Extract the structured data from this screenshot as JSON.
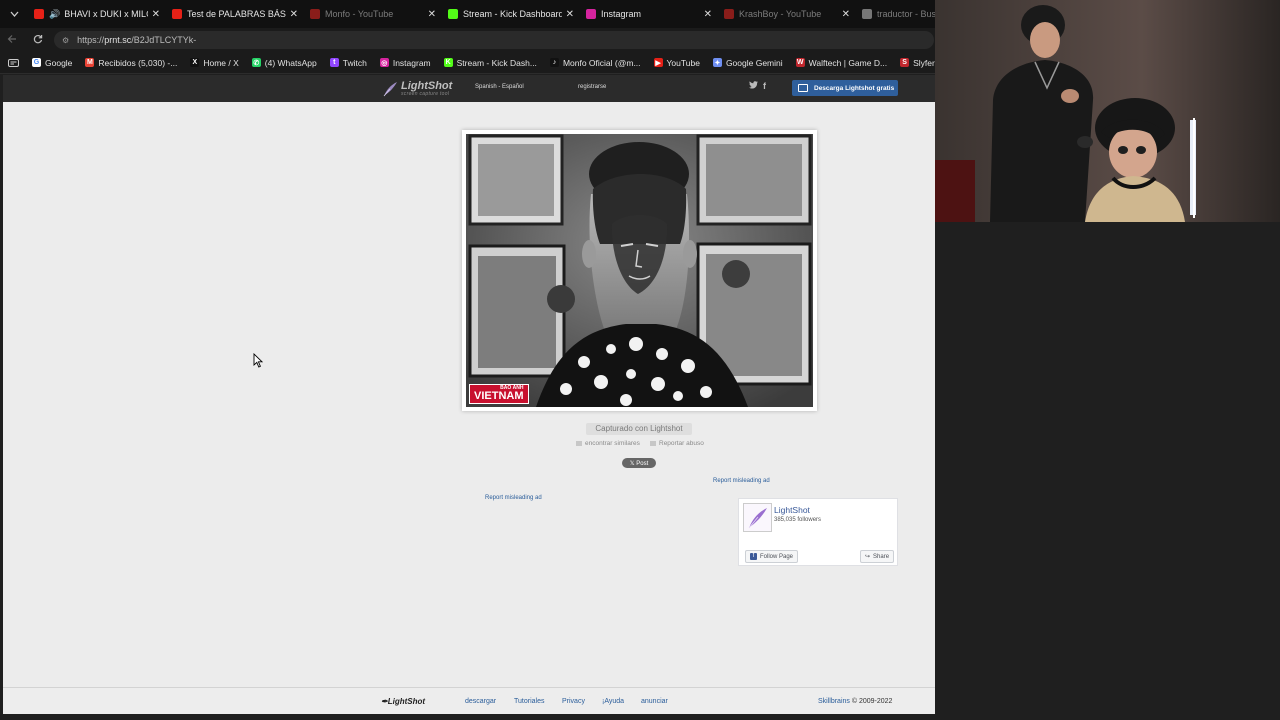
{
  "browser": {
    "tabs": [
      {
        "title": "BHAVI x DUKI x MILO J",
        "favicon": "youtube",
        "color": "#e62117",
        "active": true,
        "audio": true,
        "dim": false
      },
      {
        "title": "Test de PALABRAS BÁSICAS",
        "favicon": "youtube",
        "color": "#e62117",
        "active": false,
        "audio": false,
        "dim": false
      },
      {
        "title": "Monfo - YouTube",
        "favicon": "youtube",
        "color": "#8a1d1a",
        "active": false,
        "audio": false,
        "dim": true
      },
      {
        "title": "Stream - Kick Dashboard",
        "favicon": "kick",
        "color": "#53fc18",
        "active": false,
        "audio": false,
        "dim": false
      },
      {
        "title": "Instagram",
        "favicon": "instagram",
        "color": "#d6249f",
        "active": false,
        "audio": false,
        "dim": false
      },
      {
        "title": "KrashBoy - YouTube",
        "favicon": "youtube",
        "color": "#8a1d1a",
        "active": false,
        "audio": false,
        "dim": true
      },
      {
        "title": "traductor - Busc",
        "favicon": "google",
        "color": "#777777",
        "active": false,
        "audio": false,
        "dim": true
      }
    ],
    "url": {
      "scheme": "https://",
      "host": "prnt.sc",
      "path": "/B2JdTLCYTYk-"
    },
    "bookmarks": [
      {
        "label": "Google",
        "icon": "google-icon",
        "color": "#ffffff",
        "glyph": "G"
      },
      {
        "label": "Recibidos (5,030) -...",
        "icon": "gmail-icon",
        "color": "#ea4335",
        "glyph": "M"
      },
      {
        "label": "Home / X",
        "icon": "x-icon",
        "color": "#111111",
        "glyph": "X"
      },
      {
        "label": "(4) WhatsApp",
        "icon": "whatsapp-icon",
        "color": "#25d366",
        "glyph": "✆"
      },
      {
        "label": "Twitch",
        "icon": "twitch-icon",
        "color": "#9146ff",
        "glyph": "t"
      },
      {
        "label": "Instagram",
        "icon": "instagram-icon",
        "color": "#d6249f",
        "glyph": "◎"
      },
      {
        "label": "Stream - Kick Dash...",
        "icon": "kick-icon",
        "color": "#53fc18",
        "glyph": "K"
      },
      {
        "label": "Monfo Oficial (@m...",
        "icon": "tiktok-icon",
        "color": "#111111",
        "glyph": "♪"
      },
      {
        "label": "YouTube",
        "icon": "youtube-icon",
        "color": "#e62117",
        "glyph": "▶"
      },
      {
        "label": "Google Gemini",
        "icon": "gemini-icon",
        "color": "#6f8ff2",
        "glyph": "✦"
      },
      {
        "label": "Walftech | Game D...",
        "icon": "walftech-icon",
        "color": "#c0262d",
        "glyph": "W"
      },
      {
        "label": "Slyfer Kn",
        "icon": "slyfer-icon",
        "color": "#c0262d",
        "glyph": "S"
      }
    ]
  },
  "lightshot": {
    "logo": "LightShot",
    "tagline": "screen capture tool",
    "language": "Spanish - Español",
    "register": "registrarse",
    "download_button": "Descarga Lightshot gratis",
    "social": {
      "twitter": "t",
      "facebook": "f"
    },
    "image_watermark": "VIETNAM",
    "image_watermark_small": "BÁO ẢNH",
    "captured_label": "Capturado con Lightshot",
    "find_similar": "encontrar similares",
    "report_abuse": "Reportar abuso",
    "post_button": "𝕏 Post",
    "report_ad_right": "Report misleading ad",
    "report_ad_left": "Report misleading ad",
    "fb": {
      "name": "LightShot",
      "followers": "385,035 followers",
      "follow": "Follow Page",
      "share": "Share"
    },
    "footer": {
      "logo": "LightShot",
      "links": [
        "descargar",
        "Tutoriales",
        "Privacy",
        "¡Ayuda",
        "anunciar"
      ],
      "company": "Skillbrains",
      "copyright": " © 2009-2022"
    }
  }
}
